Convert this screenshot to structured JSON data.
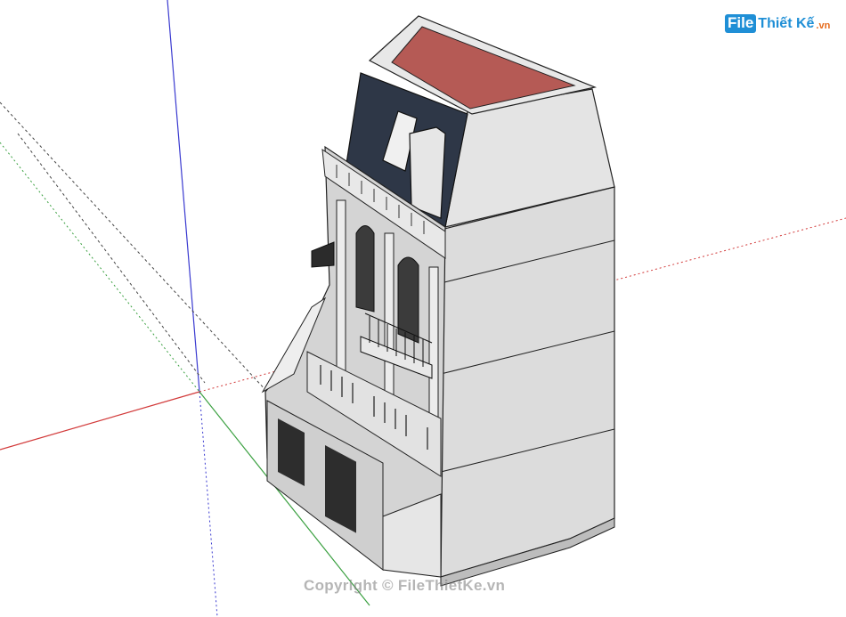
{
  "watermark": {
    "logo_mark": "File",
    "logo_word": "Thiết Kế",
    "logo_tld": ".vn",
    "copyright": "Copyright © FileThietKe.vn"
  },
  "colors": {
    "roof": "#b55a55",
    "wall": "#e2e2e2",
    "side_wall": "#d7d7d7",
    "mansard": "#2e3747",
    "axis_red": "#d23a3a",
    "axis_green": "#3aa040",
    "axis_blue": "#3a3ad0",
    "brand": "#1f8fd6"
  },
  "icons": {
    "logo": "file-thiet-ke-logo"
  }
}
